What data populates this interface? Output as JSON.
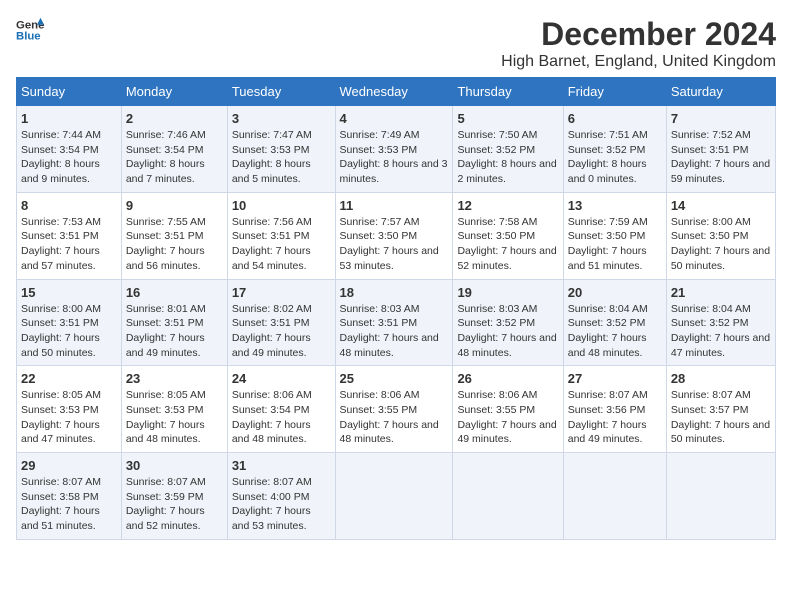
{
  "header": {
    "logo_line1": "General",
    "logo_line2": "Blue",
    "title": "December 2024",
    "subtitle": "High Barnet, England, United Kingdom"
  },
  "weekdays": [
    "Sunday",
    "Monday",
    "Tuesday",
    "Wednesday",
    "Thursday",
    "Friday",
    "Saturday"
  ],
  "weeks": [
    [
      {
        "day": "1",
        "rise": "7:44 AM",
        "set": "3:54 PM",
        "daylight": "8 hours and 9 minutes."
      },
      {
        "day": "2",
        "rise": "7:46 AM",
        "set": "3:54 PM",
        "daylight": "8 hours and 7 minutes."
      },
      {
        "day": "3",
        "rise": "7:47 AM",
        "set": "3:53 PM",
        "daylight": "8 hours and 5 minutes."
      },
      {
        "day": "4",
        "rise": "7:49 AM",
        "set": "3:53 PM",
        "daylight": "8 hours and 3 minutes."
      },
      {
        "day": "5",
        "rise": "7:50 AM",
        "set": "3:52 PM",
        "daylight": "8 hours and 2 minutes."
      },
      {
        "day": "6",
        "rise": "7:51 AM",
        "set": "3:52 PM",
        "daylight": "8 hours and 0 minutes."
      },
      {
        "day": "7",
        "rise": "7:52 AM",
        "set": "3:51 PM",
        "daylight": "7 hours and 59 minutes."
      }
    ],
    [
      {
        "day": "8",
        "rise": "7:53 AM",
        "set": "3:51 PM",
        "daylight": "7 hours and 57 minutes."
      },
      {
        "day": "9",
        "rise": "7:55 AM",
        "set": "3:51 PM",
        "daylight": "7 hours and 56 minutes."
      },
      {
        "day": "10",
        "rise": "7:56 AM",
        "set": "3:51 PM",
        "daylight": "7 hours and 54 minutes."
      },
      {
        "day": "11",
        "rise": "7:57 AM",
        "set": "3:50 PM",
        "daylight": "7 hours and 53 minutes."
      },
      {
        "day": "12",
        "rise": "7:58 AM",
        "set": "3:50 PM",
        "daylight": "7 hours and 52 minutes."
      },
      {
        "day": "13",
        "rise": "7:59 AM",
        "set": "3:50 PM",
        "daylight": "7 hours and 51 minutes."
      },
      {
        "day": "14",
        "rise": "8:00 AM",
        "set": "3:50 PM",
        "daylight": "7 hours and 50 minutes."
      }
    ],
    [
      {
        "day": "15",
        "rise": "8:00 AM",
        "set": "3:51 PM",
        "daylight": "7 hours and 50 minutes."
      },
      {
        "day": "16",
        "rise": "8:01 AM",
        "set": "3:51 PM",
        "daylight": "7 hours and 49 minutes."
      },
      {
        "day": "17",
        "rise": "8:02 AM",
        "set": "3:51 PM",
        "daylight": "7 hours and 49 minutes."
      },
      {
        "day": "18",
        "rise": "8:03 AM",
        "set": "3:51 PM",
        "daylight": "7 hours and 48 minutes."
      },
      {
        "day": "19",
        "rise": "8:03 AM",
        "set": "3:52 PM",
        "daylight": "7 hours and 48 minutes."
      },
      {
        "day": "20",
        "rise": "8:04 AM",
        "set": "3:52 PM",
        "daylight": "7 hours and 48 minutes."
      },
      {
        "day": "21",
        "rise": "8:04 AM",
        "set": "3:52 PM",
        "daylight": "7 hours and 47 minutes."
      }
    ],
    [
      {
        "day": "22",
        "rise": "8:05 AM",
        "set": "3:53 PM",
        "daylight": "7 hours and 47 minutes."
      },
      {
        "day": "23",
        "rise": "8:05 AM",
        "set": "3:53 PM",
        "daylight": "7 hours and 48 minutes."
      },
      {
        "day": "24",
        "rise": "8:06 AM",
        "set": "3:54 PM",
        "daylight": "7 hours and 48 minutes."
      },
      {
        "day": "25",
        "rise": "8:06 AM",
        "set": "3:55 PM",
        "daylight": "7 hours and 48 minutes."
      },
      {
        "day": "26",
        "rise": "8:06 AM",
        "set": "3:55 PM",
        "daylight": "7 hours and 49 minutes."
      },
      {
        "day": "27",
        "rise": "8:07 AM",
        "set": "3:56 PM",
        "daylight": "7 hours and 49 minutes."
      },
      {
        "day": "28",
        "rise": "8:07 AM",
        "set": "3:57 PM",
        "daylight": "7 hours and 50 minutes."
      }
    ],
    [
      {
        "day": "29",
        "rise": "8:07 AM",
        "set": "3:58 PM",
        "daylight": "7 hours and 51 minutes."
      },
      {
        "day": "30",
        "rise": "8:07 AM",
        "set": "3:59 PM",
        "daylight": "7 hours and 52 minutes."
      },
      {
        "day": "31",
        "rise": "8:07 AM",
        "set": "4:00 PM",
        "daylight": "7 hours and 53 minutes."
      },
      null,
      null,
      null,
      null
    ]
  ]
}
